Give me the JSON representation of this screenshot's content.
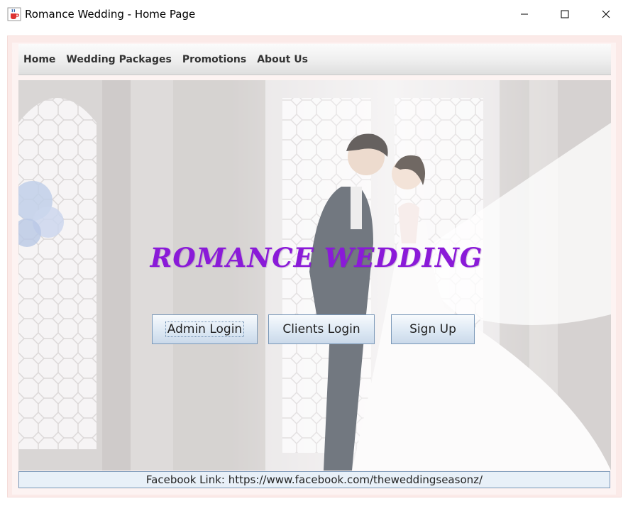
{
  "window": {
    "title": "Romance Wedding - Home Page",
    "icon": "java-cup-icon"
  },
  "menu": {
    "items": [
      {
        "label": "Home"
      },
      {
        "label": "Wedding Packages"
      },
      {
        "label": "Promotions"
      },
      {
        "label": "About Us"
      }
    ]
  },
  "hero": {
    "title": "ROMANCE WEDDING",
    "title_color": "#8a1ad8",
    "image": "wedding-couple-photo"
  },
  "buttons": {
    "admin_login": "Admin Login",
    "clients_login": "Clients Login",
    "sign_up": "Sign Up"
  },
  "footer": {
    "text": "Facebook Link: https://www.facebook.com/theweddingseasonz/"
  }
}
